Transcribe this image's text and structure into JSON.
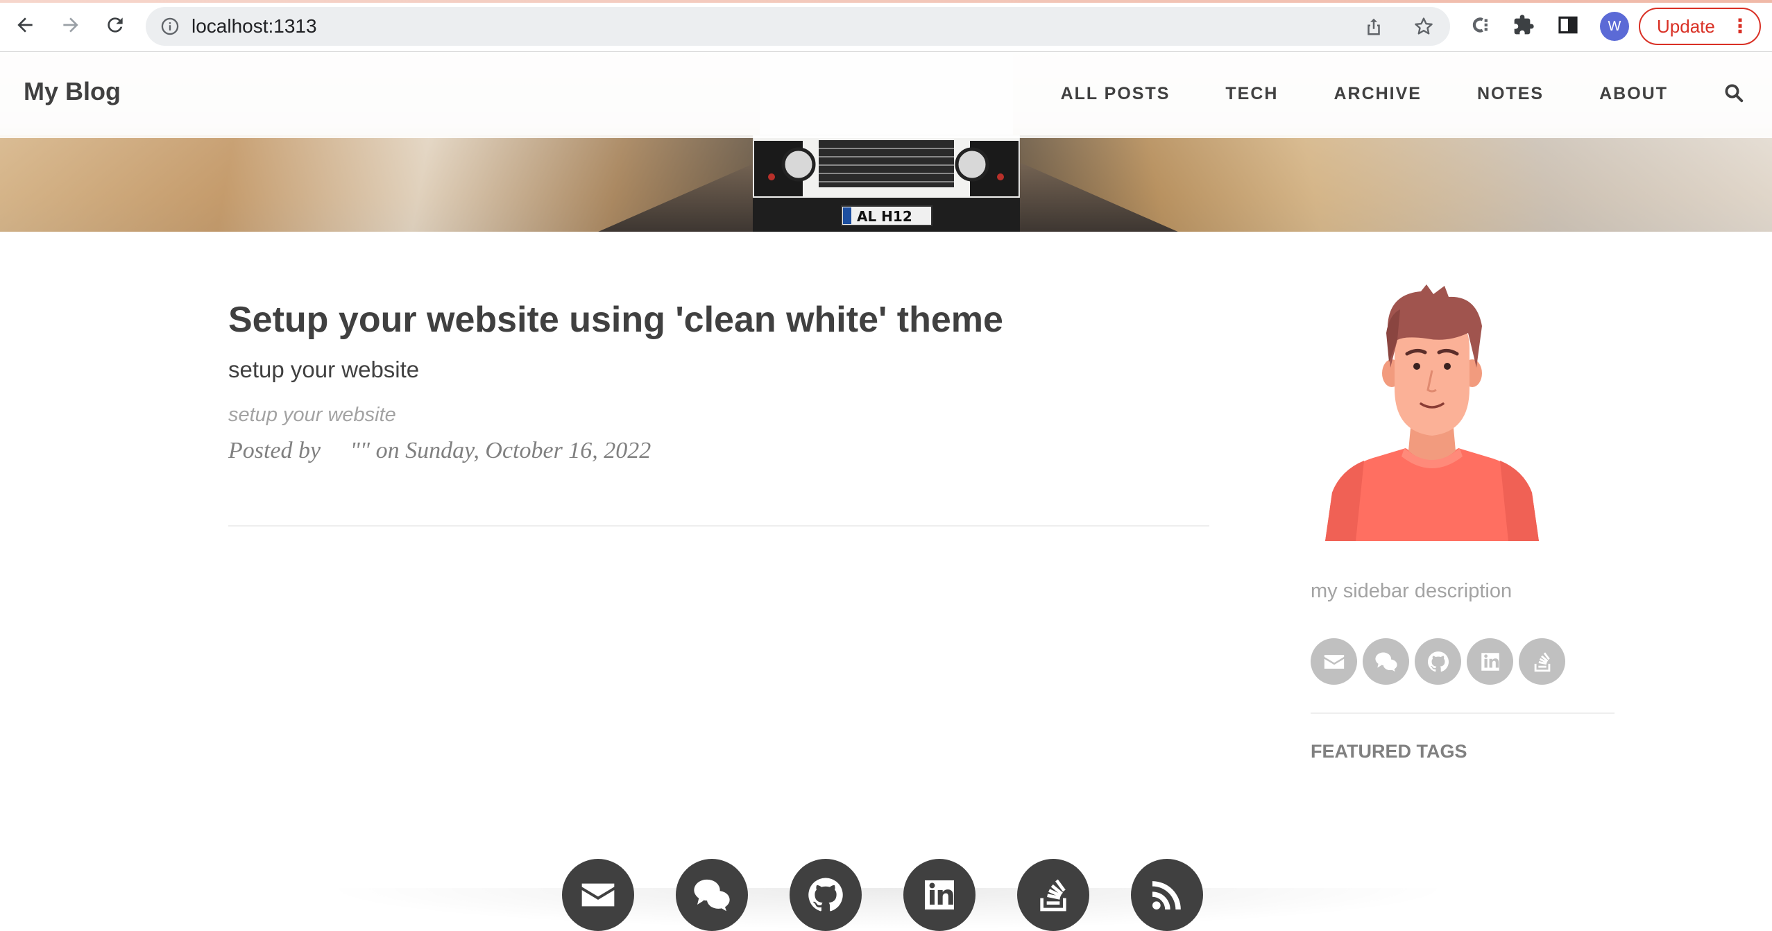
{
  "browser": {
    "url": "localhost:1313",
    "profile_initial": "W",
    "update_label": "Update"
  },
  "site": {
    "brand": "My Blog",
    "menu": [
      {
        "label": "ALL POSTS"
      },
      {
        "label": "TECH"
      },
      {
        "label": "ARCHIVE"
      },
      {
        "label": "NOTES"
      },
      {
        "label": "ABOUT"
      }
    ]
  },
  "post": {
    "title": "Setup your website using 'clean white' theme",
    "subtitle": "setup your website",
    "excerpt": "setup your website",
    "meta": "Posted by     \"\" on Sunday, October 16, 2022"
  },
  "hero": {
    "plate": "AL H12"
  },
  "sidebar": {
    "description": "my sidebar description",
    "social": [
      "envelope-icon",
      "wechat-icon",
      "github-icon",
      "linkedin-icon",
      "stackoverflow-icon"
    ],
    "featured_tags_heading": "FEATURED TAGS"
  },
  "footer": {
    "social": [
      "envelope-icon",
      "wechat-icon",
      "github-icon",
      "linkedin-icon",
      "stackoverflow-icon",
      "rss-icon"
    ]
  },
  "colors": {
    "text": "#404040",
    "muted": "#a3a3a3",
    "icon_bg_sidebar": "#c0c0c0",
    "icon_bg_footer": "#404040",
    "update_red": "#d93025",
    "avatar_shirt": "#ff6f61"
  }
}
